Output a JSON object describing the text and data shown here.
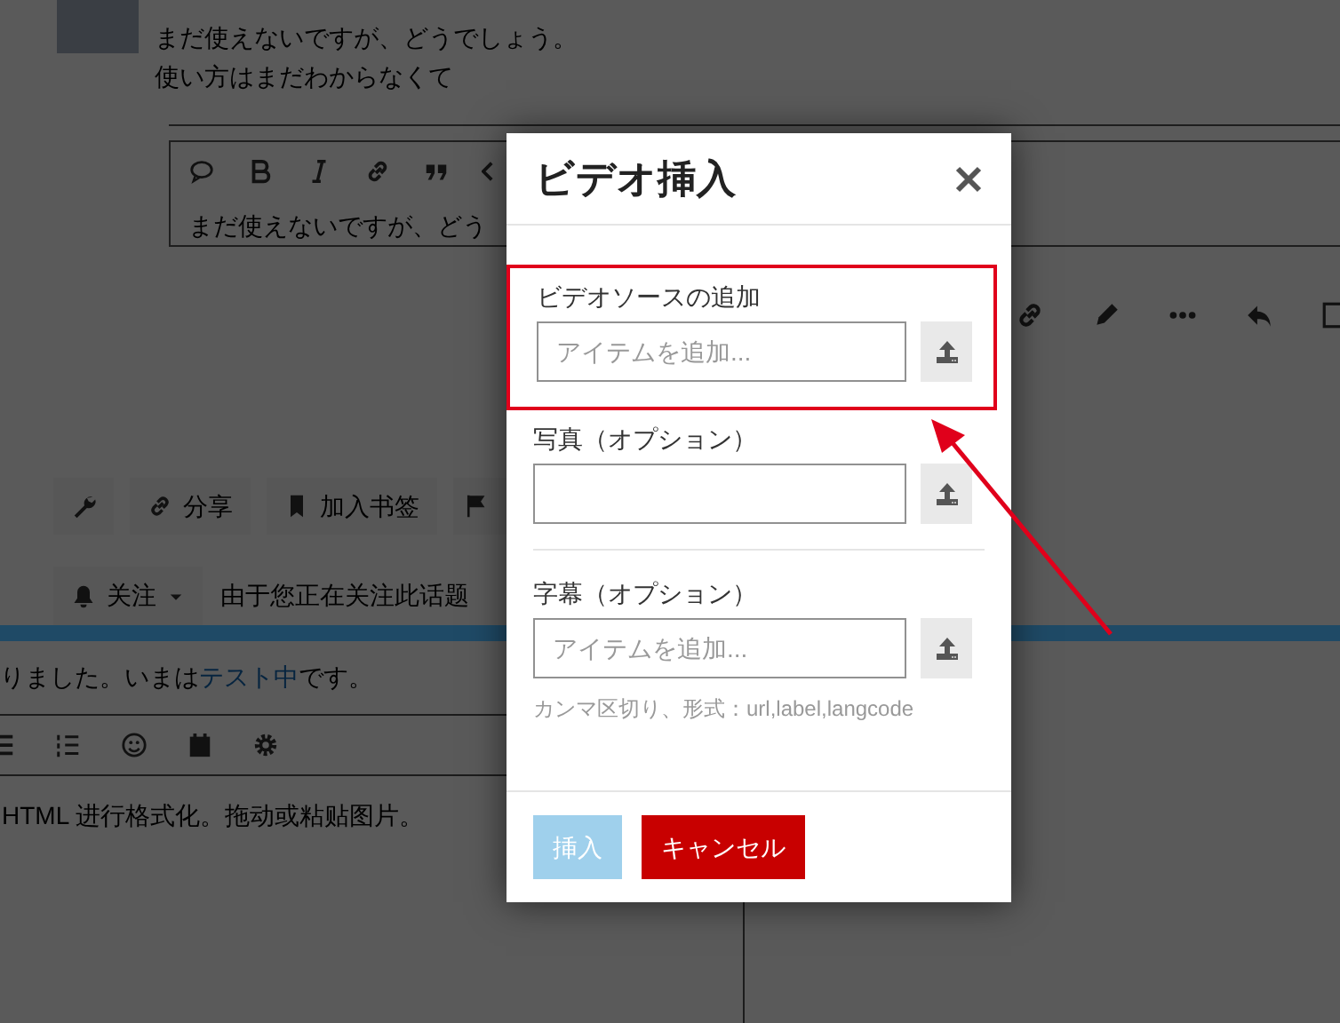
{
  "background_page": {
    "post": {
      "lines": [
        "まだ使えないですが、どうでしょう。",
        "使い方はまだわからなくて"
      ]
    },
    "editor": {
      "text": "まだ使えないですが、どう"
    },
    "topic_buttons": [
      {
        "label": "分享"
      },
      {
        "label": "加入书签"
      }
    ],
    "notification": {
      "button": "关注",
      "text": "由于您正在关注此话题"
    },
    "reply_notice": {
      "before": "りました。いまは",
      "link": "テスト中",
      "after": "です。"
    },
    "composer_hint": "HTML 进行格式化。拖动或粘贴图片。"
  },
  "dialog": {
    "title": "ビデオ挿入",
    "fields": [
      {
        "label": "ビデオソースの追加",
        "placeholder": "アイテムを追加...",
        "highlighted": true
      },
      {
        "label": "写真（オプション）",
        "highlighted": false
      },
      {
        "label": "字幕（オプション）",
        "placeholder": "アイテムを追加...",
        "hint": "カンマ区切り、形式：url,label,langcode",
        "highlighted": false
      }
    ],
    "buttons": [
      {
        "label": "挿入",
        "kind": "primary",
        "disabled": true
      },
      {
        "label": "キャンセル",
        "kind": "danger",
        "disabled": false
      }
    ]
  },
  "annotation": {
    "arrow": true
  }
}
